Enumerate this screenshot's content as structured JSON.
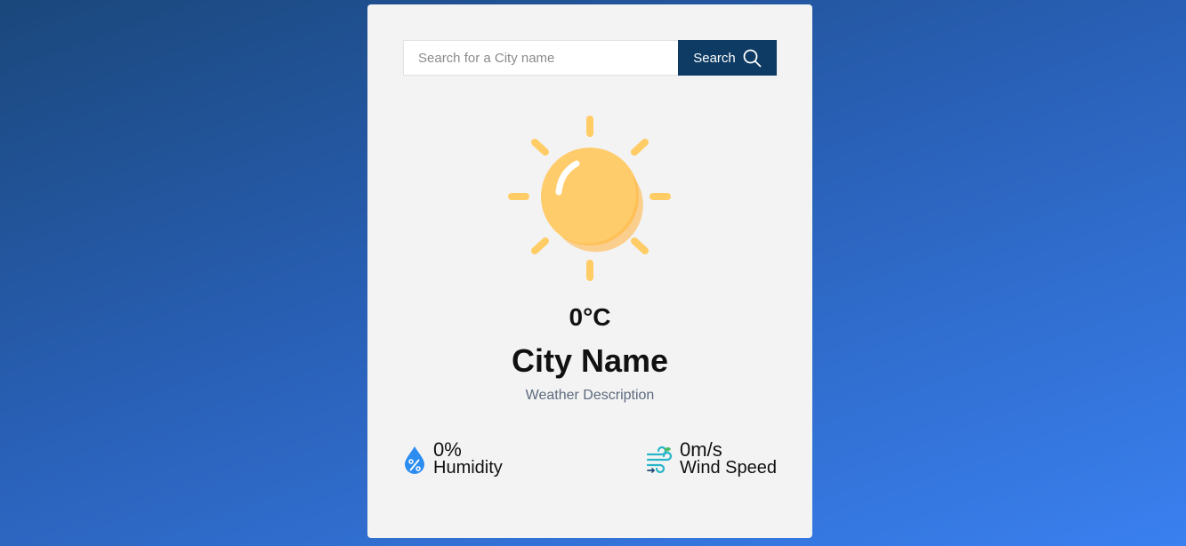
{
  "search": {
    "placeholder": "Search for a City name",
    "value": "",
    "button_label": "Search",
    "button_icon": "search-icon"
  },
  "weather": {
    "icon": "sun-icon",
    "temperature": "0°C",
    "city": "City Name",
    "description": "Weather Description"
  },
  "stats": {
    "humidity": {
      "value": "0%",
      "label": "Humidity",
      "icon": "humidity-drop-icon"
    },
    "wind": {
      "value": "0m/s",
      "label": "Wind Speed",
      "icon": "wind-icon"
    }
  },
  "colors": {
    "background_start": "#1a477b",
    "background_end": "#3a80f0",
    "card": "#f3f3f3",
    "button": "#0e3b63",
    "sun": "#ffcc66",
    "humidity_icon": "#2d8cf0",
    "wind_icon": "#27b6c9"
  }
}
